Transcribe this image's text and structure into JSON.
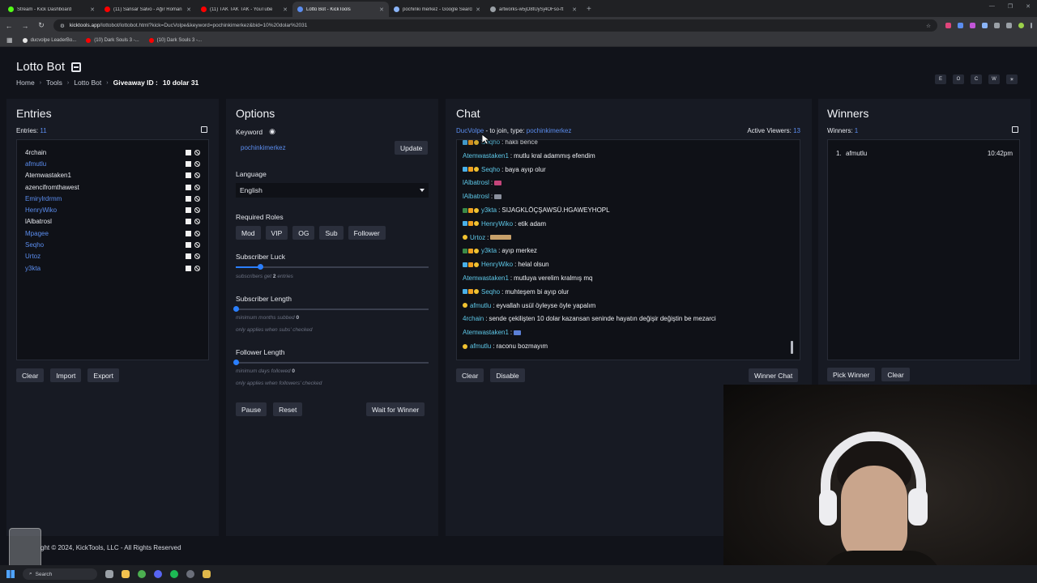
{
  "browser": {
    "tabs": [
      {
        "title": "Stream - Kick Dashboard",
        "color": "#53fc18"
      },
      {
        "title": "(11) Sansar Salvo - Ağır Roman",
        "color": "#ff0000"
      },
      {
        "title": "(11) TAK TAK TAK - YouTube",
        "color": "#ff0000"
      },
      {
        "title": "Lotto Bot - KickTools",
        "color": "#5b8def"
      },
      {
        "title": "pochinki merkez - Google Search",
        "color": "#8ab4f8"
      },
      {
        "title": "artworks-w5jO8tUySj4OFso-ft",
        "color": "#9aa0a6"
      }
    ],
    "url_host": "kicktools.app",
    "url_path": "/lottobot/lottobot.html?kick=DucVolpe&keyword=pochinkimerkez&bid=10%20dolar%2031",
    "bookmarks": [
      "ducvolpe LeaderBo...",
      "(10) Dark Souls 3 -...",
      "(10) Dark Souls 3 -..."
    ]
  },
  "header": {
    "title": "Lotto Bot",
    "breadcrumb": [
      "Home",
      "Tools",
      "Lotto Bot"
    ],
    "giveaway_label": "Giveaway ID :",
    "giveaway_id": "10 dolar 31",
    "top_buttons": [
      "E",
      "O",
      "C",
      "W",
      "☀"
    ]
  },
  "entries": {
    "heading": "Entries",
    "count_label": "Entries:",
    "count": "11",
    "list": [
      {
        "name": "4rchain",
        "color": "#e6e8ee"
      },
      {
        "name": "afmutlu",
        "color": "#5b8def"
      },
      {
        "name": "Atemwastaken1",
        "color": "#e6e8ee"
      },
      {
        "name": "azencifromthawest",
        "color": "#e6e8ee"
      },
      {
        "name": "Emirylrdrmm",
        "color": "#5b8def"
      },
      {
        "name": "HenryWiko",
        "color": "#5b8def"
      },
      {
        "name": "lAlbatrosl",
        "color": "#e6e8ee"
      },
      {
        "name": "Mpagee",
        "color": "#5b8def"
      },
      {
        "name": "Seqho",
        "color": "#5b8def"
      },
      {
        "name": "Urtoz",
        "color": "#5b8def"
      },
      {
        "name": "y3kta",
        "color": "#5b8def"
      }
    ],
    "buttons": {
      "clear": "Clear",
      "import": "Import",
      "export": "Export"
    }
  },
  "options": {
    "heading": "Options",
    "keyword_label": "Keyword",
    "keyword_value": "pochinkimerkez",
    "update": "Update",
    "language_label": "Language",
    "language_value": "English",
    "roles_label": "Required Roles",
    "roles": [
      "Mod",
      "VIP",
      "OG",
      "Sub",
      "Follower"
    ],
    "sub_luck_label": "Subscriber Luck",
    "sub_luck_hint_pre": "subscribers get",
    "sub_luck_value": "2",
    "sub_luck_hint_post": "entries",
    "sub_luck_fraction": 0.125,
    "sub_length_label": "Subscriber Length",
    "sub_length_hint_pre": "minimum months subbed",
    "sub_length_value": "0",
    "sub_length_hint2": "only applies when subs' checked",
    "sub_length_fraction": 0,
    "follow_label": "Follower Length",
    "follow_hint_pre": "minimum days followed",
    "follow_value": "0",
    "follow_hint2": "only applies when followers' checked",
    "follow_fraction": 0,
    "pause": "Pause",
    "reset": "Reset",
    "wait": "Wait for Winner"
  },
  "chat": {
    "heading": "Chat",
    "channel": "DucVolpe",
    "join_text": "- to join, type:",
    "join_keyword": "pochinkimerkez",
    "viewers_label": "Active Viewers:",
    "viewers": "13",
    "messages": [
      {
        "user": "Seqho",
        "text": "hakli bence",
        "badges": [
          "sub",
          "og",
          "star"
        ],
        "partial": true
      },
      {
        "user": "Atemwastaken1",
        "text": "mutlu kral adammış efendim",
        "badges": []
      },
      {
        "user": "Seqho",
        "text": "baya ayıp olur",
        "badges": [
          "sub",
          "og",
          "star"
        ]
      },
      {
        "user": "lAlbatrosl",
        "text": "",
        "badges": [],
        "emote": "pink"
      },
      {
        "user": "lAlbatrosl",
        "text": "",
        "badges": [],
        "emote": "knife"
      },
      {
        "user": "y3kta",
        "text": "SIJAGKLÖÇŞAWSÜ.HGAWEYHOPL",
        "badges": [
          "mod",
          "og",
          "star"
        ]
      },
      {
        "user": "HenryWiko",
        "text": "etik adam",
        "badges": [
          "sub",
          "og",
          "star"
        ]
      },
      {
        "user": "Urtoz",
        "text": "",
        "badges": [
          "star"
        ],
        "emote": "faces"
      },
      {
        "user": "y3kta",
        "text": "ayıp merkez",
        "badges": [
          "mod",
          "og",
          "star"
        ]
      },
      {
        "user": "HenryWiko",
        "text": "helal olsun",
        "badges": [
          "sub",
          "og",
          "star"
        ]
      },
      {
        "user": "Atemwastaken1",
        "text": "mutluya verelim kralmış mq",
        "badges": []
      },
      {
        "user": "Seqho",
        "text": "muhteşem bi ayıp olur",
        "badges": [
          "sub",
          "og",
          "star"
        ]
      },
      {
        "user": "afmutlu",
        "text": "eyvallah usül öyleyse öyle yapalım",
        "badges": [
          "star"
        ]
      },
      {
        "user": "4rchain",
        "text": "sende çekilişten 10 dolar kazansan seninde hayatın değişir değiştin be mezarci",
        "badges": []
      },
      {
        "user": "Atemwastaken1",
        "text": "",
        "badges": [],
        "emote": "blue"
      },
      {
        "user": "afmutlu",
        "text": "raconu bozmayım",
        "badges": [
          "star"
        ]
      }
    ],
    "buttons": {
      "clear": "Clear",
      "disable": "Disable",
      "winner_chat": "Winner Chat"
    }
  },
  "winners": {
    "heading": "Winners",
    "count_label": "Winners:",
    "count": "1",
    "list": [
      {
        "rank": "1.",
        "name": "afmutlu",
        "time": "10:42pm"
      }
    ],
    "buttons": {
      "pick": "Pick Winner",
      "clear": "Clear"
    }
  },
  "footer": {
    "text": "ght © 2024, KickTools, LLC - All Rights Reserved"
  },
  "taskbar": {
    "search": "Search"
  }
}
